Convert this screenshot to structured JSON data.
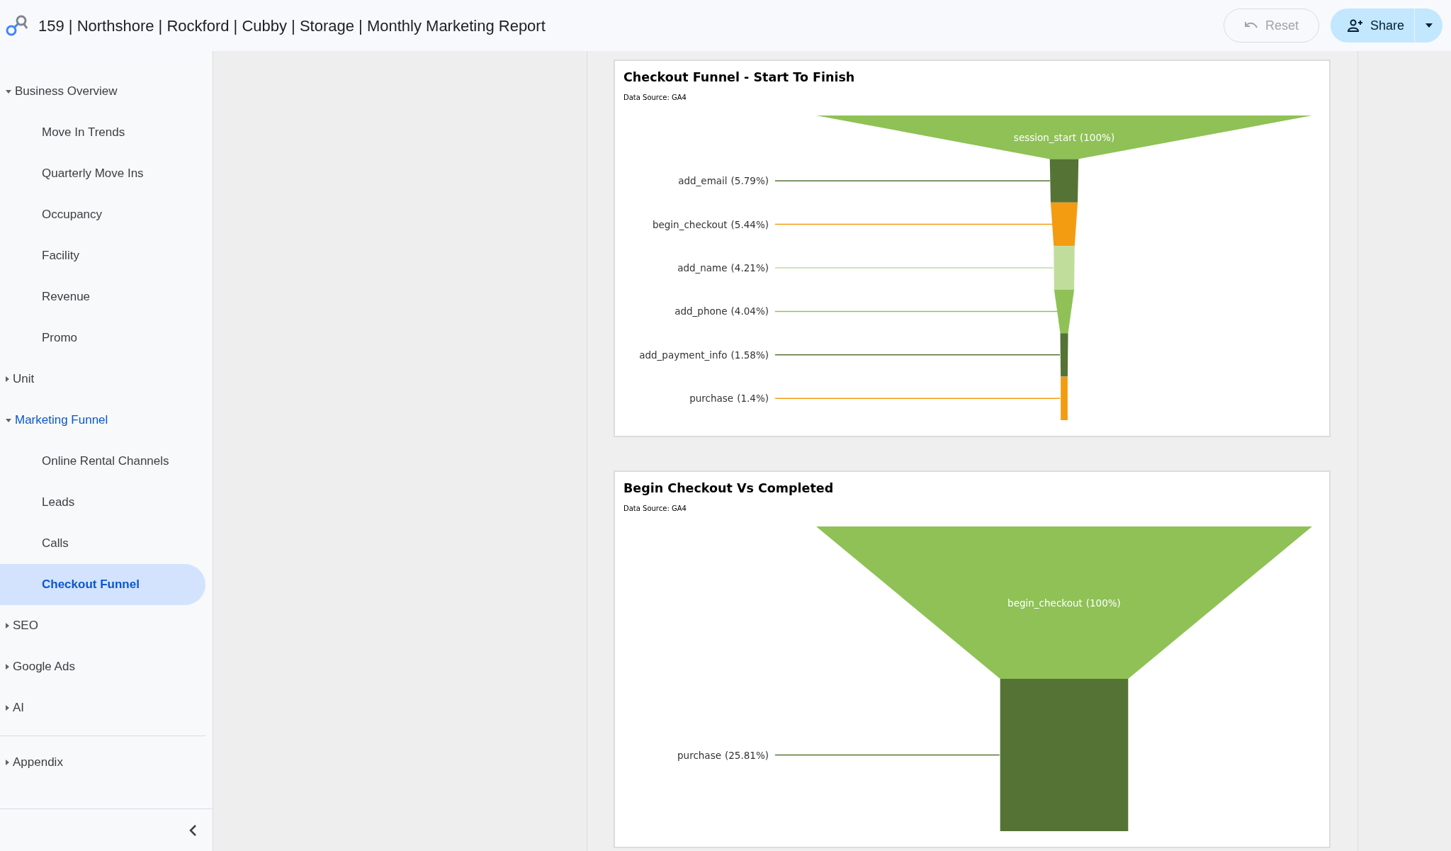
{
  "header": {
    "title": "159 | Northshore | Rockford | Cubby | Storage | Monthly Marketing Report",
    "buttons": [
      {
        "label": "Reset",
        "kind": "reset",
        "disabled": true
      },
      {
        "label": "Share",
        "kind": "share",
        "disabled": false
      }
    ]
  },
  "sidebar": {
    "sections": [
      {
        "items": [
          {
            "label": "Business Overview",
            "expanded": true,
            "children": [
              {
                "label": "Move In Trends",
                "selected": false
              },
              {
                "label": "Quarterly Move Ins",
                "selected": false
              },
              {
                "label": "Occupancy",
                "selected": false
              },
              {
                "label": "Facility",
                "selected": false
              },
              {
                "label": "Revenue",
                "selected": false
              },
              {
                "label": "Promo",
                "selected": false
              }
            ]
          },
          {
            "label": "Unit",
            "expanded": false
          },
          {
            "label": "Marketing Funnel",
            "expanded": true,
            "children": [
              {
                "label": "Online Rental Channels",
                "selected": false
              },
              {
                "label": "Leads",
                "selected": false
              },
              {
                "label": "Calls",
                "selected": false
              },
              {
                "label": "Checkout Funnel",
                "selected": true
              }
            ]
          },
          {
            "label": "SEO",
            "expanded": false
          },
          {
            "label": "Google Ads",
            "expanded": false
          },
          {
            "label": "AI",
            "expanded": false
          }
        ]
      },
      {
        "items": [
          {
            "label": "Appendix",
            "expanded": false
          }
        ]
      }
    ]
  },
  "charts": [
    {
      "title": "Checkout Funnel - Start To Finish",
      "source": "Data Source: GA4",
      "stages": [
        {
          "name": "session_start",
          "share": "(100%)",
          "color": "#8fc156"
        },
        {
          "name": "add_email",
          "share": "(5.79%)",
          "color": "#557335"
        },
        {
          "name": "begin_checkout",
          "share": "(5.44%)",
          "color": "#f39c12"
        },
        {
          "name": "add_name",
          "share": "(4.21%)",
          "color": "#c0dd9c"
        },
        {
          "name": "add_phone",
          "share": "(4.04%)",
          "color": "#8fc156"
        },
        {
          "name": "add_payment_info",
          "share": "(1.58%)",
          "color": "#557335"
        },
        {
          "name": "purchase",
          "share": "(1.4%)",
          "color": "#f39c12"
        }
      ]
    },
    {
      "title": "Begin Checkout Vs Completed",
      "source": "Data Source: GA4",
      "stages": [
        {
          "name": "begin_checkout",
          "share": "(100%)",
          "color": "#8fc156"
        },
        {
          "name": "purchase",
          "share": "(25.81%)",
          "color": "#557335"
        }
      ]
    }
  ]
}
